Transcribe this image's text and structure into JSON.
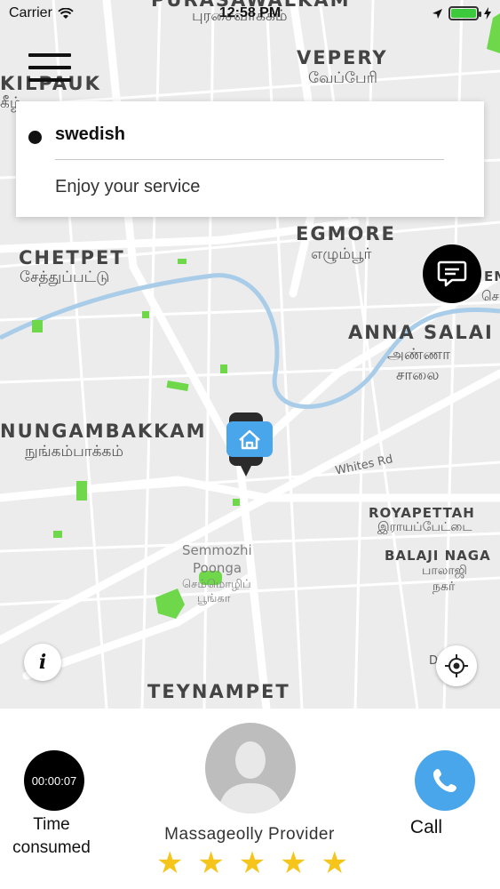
{
  "status_bar": {
    "carrier": "Carrier",
    "time": "12:58 PM"
  },
  "map": {
    "labels": {
      "purasawalkam": "PURASAWALKAM",
      "purasawalkam_ta": "புரசைவாக்கம்",
      "vepery": "VEPERY",
      "vepery_ta": "வேப்பேரி",
      "kilpauk": "KILPAUK",
      "kilpauk_ta": "கீழ்",
      "egmore": "EGMORE",
      "egmore_ta": "எழும்பூர்",
      "chetpet": "CHETPET",
      "chetpet_ta": "சேத்துப்பட்டு",
      "anna_salai": "ANNA SALAI",
      "anna_salai_ta_1": "அண்ணா",
      "anna_salai_ta_2": "சாலை",
      "nungambakkam": "NUNGAMBAKKAM",
      "nungambakkam_ta": "நுங்கம்பாக்கம்",
      "whites_rd": "Whites Rd",
      "royapettah": "ROYAPETTAH",
      "royapettah_ta": "இராயப்பேட்டை",
      "balaji_nagar": "BALAJI NAGA",
      "balaji_nagar_ta_1": "பாலாஜி",
      "balaji_nagar_ta_2": "நகர்",
      "semmozhi": "Semmozhi",
      "poonga": "Poonga",
      "semmozhi_ta": "செம்மொழிப்",
      "poonga_ta": "பூங்கா",
      "teynampet": "TEYNAMPET",
      "krish": "D Kris",
      "em": "EM",
      "em_ta": "செ"
    }
  },
  "booking_card": {
    "name": "swedish",
    "message": "Enjoy your service"
  },
  "bottom_panel": {
    "timer": "00:00:07",
    "timer_label_1": "Time",
    "timer_label_2": "consumed",
    "provider_name": "Massageolly Provider",
    "rating": 5,
    "stars": [
      "★",
      "★",
      "★",
      "★",
      "★"
    ],
    "call_label": "Call"
  },
  "colors": {
    "call_button": "#4aa6ea",
    "star": "#f6c51b",
    "pin": "#4aa6ea",
    "water": "#a9cde8",
    "park": "#6fd84a"
  },
  "icons": {
    "menu": "hamburger-icon",
    "chat": "chat-icon",
    "pin": "home-pin-icon",
    "info": "info-icon",
    "locate": "crosshair-icon",
    "call": "phone-icon",
    "avatar": "person-icon"
  }
}
